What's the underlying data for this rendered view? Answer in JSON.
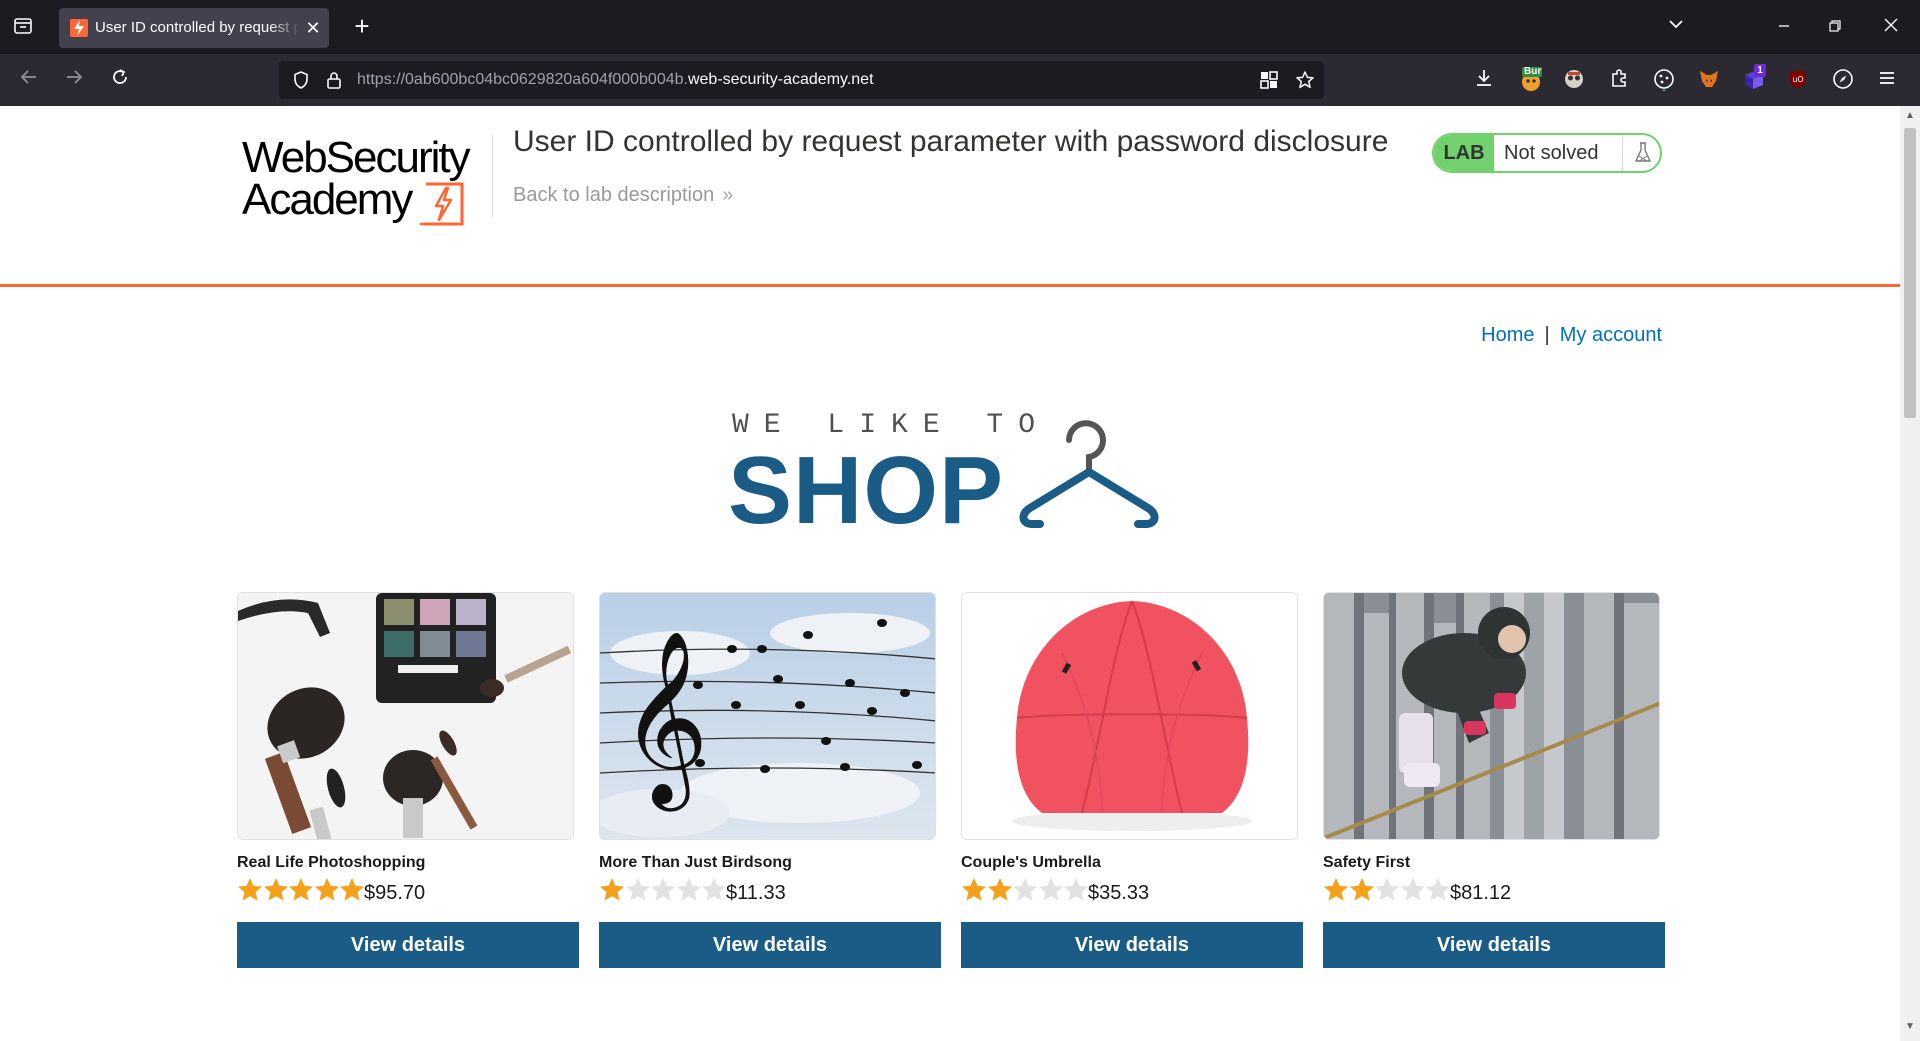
{
  "browser": {
    "tab_title": "User ID controlled by request parameter with password disclosure",
    "url_prefix": "https://0ab600bc04bc0629820a604f000b004b.",
    "url_domain": "web-security-academy.net",
    "extension_badges": {
      "burp": "Bur",
      "counter": "1"
    }
  },
  "header": {
    "logo_line1": "WebSecurity",
    "logo_line2": "Academy",
    "lab_title": "User ID controlled by request parameter with password disclosure",
    "back_link": "Back to lab description",
    "back_chevron": "»",
    "lab_badge": "LAB",
    "lab_state": "Not solved"
  },
  "nav": {
    "home": "Home",
    "separator": "|",
    "my_account": "My account"
  },
  "hero": {
    "small": "WE LIKE TO",
    "big": "SHOP"
  },
  "products": [
    {
      "name": "Real Life Photoshopping",
      "rating": 5,
      "price": "$95.70",
      "button": "View details"
    },
    {
      "name": "More Than Just Birdsong",
      "rating": 1,
      "price": "$11.33",
      "button": "View details"
    },
    {
      "name": "Couple's Umbrella",
      "rating": 2,
      "price": "$35.33",
      "button": "View details"
    },
    {
      "name": "Safety First",
      "rating": 2,
      "price": "$81.12",
      "button": "View details"
    }
  ],
  "colors": {
    "accent_orange": "#ff6633",
    "link_blue": "#0071bc",
    "button_blue": "#1b5c87",
    "lab_green": "#70d16d",
    "star_gold": "#f4a11c",
    "star_empty": "#e2e2e2"
  }
}
